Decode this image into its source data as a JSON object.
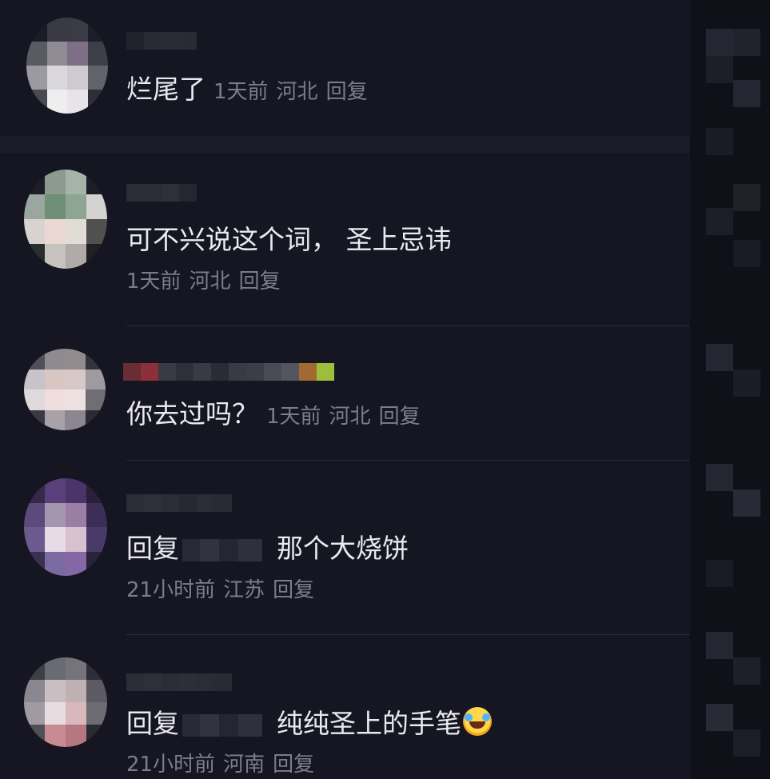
{
  "comments": [
    {
      "text": "烂尾了",
      "time": "1天前",
      "location": "河北",
      "reply_label": "回复"
    },
    {
      "text": "可不兴说这个词，  圣上忌讳",
      "time": "1天前",
      "location": "河北",
      "reply_label": "回复"
    },
    {
      "text": "你去过吗？",
      "time": "1天前",
      "location": "河北",
      "reply_label": "回复"
    },
    {
      "reply_prefix": "回复",
      "text": "那个大烧饼",
      "time": "21小时前",
      "location": "江苏",
      "reply_label": "回复"
    },
    {
      "reply_prefix": "回复",
      "text": "纯纯圣上的手笔",
      "emoji": "rolling-on-floor-laughing-emoji",
      "time": "21小时前",
      "location": "河南",
      "reply_label": "回复"
    }
  ],
  "colors": {
    "background": "#161622",
    "text_primary": "#e9e9ef",
    "text_secondary": "#7c7c8c",
    "divider": "#2c2c3a"
  }
}
